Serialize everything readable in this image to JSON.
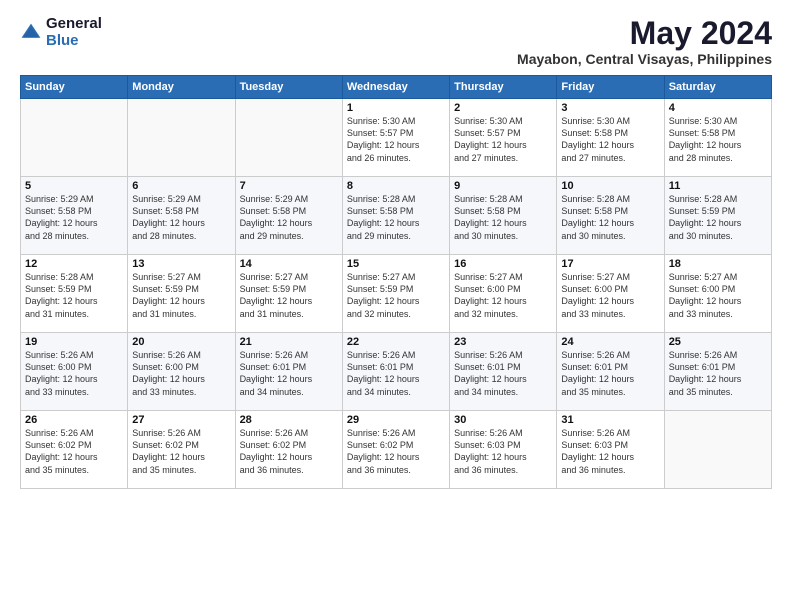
{
  "header": {
    "logo_general": "General",
    "logo_blue": "Blue",
    "month": "May 2024",
    "location": "Mayabon, Central Visayas, Philippines"
  },
  "weekdays": [
    "Sunday",
    "Monday",
    "Tuesday",
    "Wednesday",
    "Thursday",
    "Friday",
    "Saturday"
  ],
  "weeks": [
    [
      {
        "day": "",
        "info": ""
      },
      {
        "day": "",
        "info": ""
      },
      {
        "day": "",
        "info": ""
      },
      {
        "day": "1",
        "info": "Sunrise: 5:30 AM\nSunset: 5:57 PM\nDaylight: 12 hours\nand 26 minutes."
      },
      {
        "day": "2",
        "info": "Sunrise: 5:30 AM\nSunset: 5:57 PM\nDaylight: 12 hours\nand 27 minutes."
      },
      {
        "day": "3",
        "info": "Sunrise: 5:30 AM\nSunset: 5:58 PM\nDaylight: 12 hours\nand 27 minutes."
      },
      {
        "day": "4",
        "info": "Sunrise: 5:30 AM\nSunset: 5:58 PM\nDaylight: 12 hours\nand 28 minutes."
      }
    ],
    [
      {
        "day": "5",
        "info": "Sunrise: 5:29 AM\nSunset: 5:58 PM\nDaylight: 12 hours\nand 28 minutes."
      },
      {
        "day": "6",
        "info": "Sunrise: 5:29 AM\nSunset: 5:58 PM\nDaylight: 12 hours\nand 28 minutes."
      },
      {
        "day": "7",
        "info": "Sunrise: 5:29 AM\nSunset: 5:58 PM\nDaylight: 12 hours\nand 29 minutes."
      },
      {
        "day": "8",
        "info": "Sunrise: 5:28 AM\nSunset: 5:58 PM\nDaylight: 12 hours\nand 29 minutes."
      },
      {
        "day": "9",
        "info": "Sunrise: 5:28 AM\nSunset: 5:58 PM\nDaylight: 12 hours\nand 30 minutes."
      },
      {
        "day": "10",
        "info": "Sunrise: 5:28 AM\nSunset: 5:58 PM\nDaylight: 12 hours\nand 30 minutes."
      },
      {
        "day": "11",
        "info": "Sunrise: 5:28 AM\nSunset: 5:59 PM\nDaylight: 12 hours\nand 30 minutes."
      }
    ],
    [
      {
        "day": "12",
        "info": "Sunrise: 5:28 AM\nSunset: 5:59 PM\nDaylight: 12 hours\nand 31 minutes."
      },
      {
        "day": "13",
        "info": "Sunrise: 5:27 AM\nSunset: 5:59 PM\nDaylight: 12 hours\nand 31 minutes."
      },
      {
        "day": "14",
        "info": "Sunrise: 5:27 AM\nSunset: 5:59 PM\nDaylight: 12 hours\nand 31 minutes."
      },
      {
        "day": "15",
        "info": "Sunrise: 5:27 AM\nSunset: 5:59 PM\nDaylight: 12 hours\nand 32 minutes."
      },
      {
        "day": "16",
        "info": "Sunrise: 5:27 AM\nSunset: 6:00 PM\nDaylight: 12 hours\nand 32 minutes."
      },
      {
        "day": "17",
        "info": "Sunrise: 5:27 AM\nSunset: 6:00 PM\nDaylight: 12 hours\nand 33 minutes."
      },
      {
        "day": "18",
        "info": "Sunrise: 5:27 AM\nSunset: 6:00 PM\nDaylight: 12 hours\nand 33 minutes."
      }
    ],
    [
      {
        "day": "19",
        "info": "Sunrise: 5:26 AM\nSunset: 6:00 PM\nDaylight: 12 hours\nand 33 minutes."
      },
      {
        "day": "20",
        "info": "Sunrise: 5:26 AM\nSunset: 6:00 PM\nDaylight: 12 hours\nand 33 minutes."
      },
      {
        "day": "21",
        "info": "Sunrise: 5:26 AM\nSunset: 6:01 PM\nDaylight: 12 hours\nand 34 minutes."
      },
      {
        "day": "22",
        "info": "Sunrise: 5:26 AM\nSunset: 6:01 PM\nDaylight: 12 hours\nand 34 minutes."
      },
      {
        "day": "23",
        "info": "Sunrise: 5:26 AM\nSunset: 6:01 PM\nDaylight: 12 hours\nand 34 minutes."
      },
      {
        "day": "24",
        "info": "Sunrise: 5:26 AM\nSunset: 6:01 PM\nDaylight: 12 hours\nand 35 minutes."
      },
      {
        "day": "25",
        "info": "Sunrise: 5:26 AM\nSunset: 6:01 PM\nDaylight: 12 hours\nand 35 minutes."
      }
    ],
    [
      {
        "day": "26",
        "info": "Sunrise: 5:26 AM\nSunset: 6:02 PM\nDaylight: 12 hours\nand 35 minutes."
      },
      {
        "day": "27",
        "info": "Sunrise: 5:26 AM\nSunset: 6:02 PM\nDaylight: 12 hours\nand 35 minutes."
      },
      {
        "day": "28",
        "info": "Sunrise: 5:26 AM\nSunset: 6:02 PM\nDaylight: 12 hours\nand 36 minutes."
      },
      {
        "day": "29",
        "info": "Sunrise: 5:26 AM\nSunset: 6:02 PM\nDaylight: 12 hours\nand 36 minutes."
      },
      {
        "day": "30",
        "info": "Sunrise: 5:26 AM\nSunset: 6:03 PM\nDaylight: 12 hours\nand 36 minutes."
      },
      {
        "day": "31",
        "info": "Sunrise: 5:26 AM\nSunset: 6:03 PM\nDaylight: 12 hours\nand 36 minutes."
      },
      {
        "day": "",
        "info": ""
      }
    ]
  ]
}
